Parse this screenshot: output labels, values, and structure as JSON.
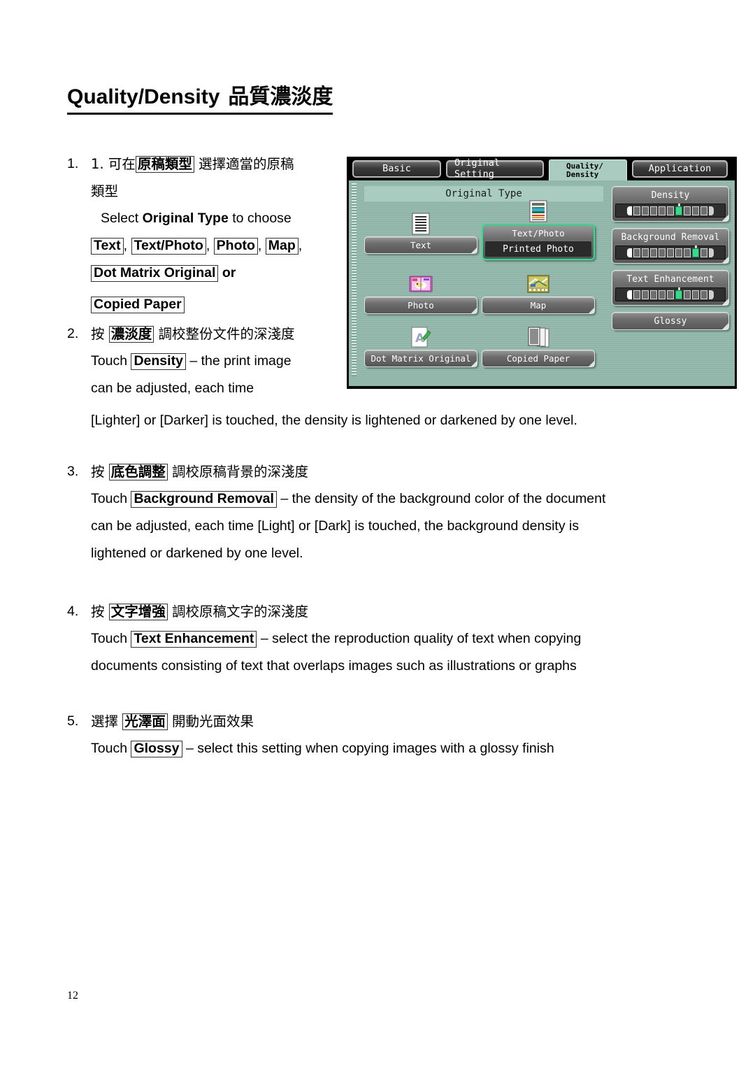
{
  "document": {
    "title_en": "Quality/Density",
    "title_cjk": "品質濃淡度",
    "page_number": "12"
  },
  "steps": [
    {
      "num": "1.",
      "cjk_num": "1.",
      "cjk_lead": "可在",
      "cjk_boxed": "原稿類型",
      "cjk_tail": "選擇適當的原稿",
      "cjk_line2": "類型",
      "en_lead": "Select",
      "en_bold": "Original Type",
      "en_tail": "to choose",
      "options": [
        "Text",
        "Text/Photo",
        "Photo",
        "Map",
        "Dot Matrix Original",
        "Copied Paper"
      ],
      "en_or": "or"
    },
    {
      "num": "2.",
      "cjk_lead": "按",
      "cjk_boxed": "濃淡度",
      "cjk_tail": "調校整份文件的深淺度",
      "en_lead": "Touch",
      "en_boxed": "Density",
      "en_line1": "– the print image",
      "en_line2": "can be adjusted, each time",
      "en_line3": "[Lighter] or [Darker] is touched, the density is lightened or darkened by one level."
    },
    {
      "num": "3.",
      "cjk_lead": "按",
      "cjk_boxed": "底色調整",
      "cjk_tail": "調校原稿背景的深淺度",
      "en_lead": "Touch",
      "en_boxed": "Background Removal",
      "en_line1": "– the density of the background color of the document",
      "en_line2": "can be adjusted, each time [Light] or [Dark] is touched, the background density is",
      "en_line3": "lightened or darkened by one level."
    },
    {
      "num": "4.",
      "cjk_lead": "按",
      "cjk_boxed": "文字增強",
      "cjk_tail": "調校原稿文字的深淺度",
      "en_lead": "Touch",
      "en_boxed": "Text Enhancement",
      "en_line1": "– select the reproduction quality of text when copying",
      "en_line2": "documents consisting of text that overlaps images such as illustrations or graphs"
    },
    {
      "num": "5.",
      "cjk_lead": "選擇",
      "cjk_boxed": "光澤面",
      "cjk_tail": "開動光面效果",
      "en_lead": "Touch",
      "en_boxed": "Glossy",
      "en_line1": "– select this setting when copying images with a glossy finish"
    }
  ],
  "copier_ui": {
    "tabs": [
      {
        "label": "Basic",
        "active": false
      },
      {
        "label": "Original Setting",
        "active": false
      },
      {
        "label_line1": "Quality/",
        "label_line2": "Density",
        "active": true
      },
      {
        "label": "Application",
        "active": false
      }
    ],
    "section_header": "Original Type",
    "original_types": [
      {
        "label": "Text",
        "icon": "document-lines-icon",
        "selected": false
      },
      {
        "label": "Text/Photo",
        "sub_label": "Printed Photo",
        "icon": "text-photo-icon",
        "selected": true
      },
      {
        "label": "Photo",
        "icon": "photo-album-icon",
        "selected": false
      },
      {
        "label": "Map",
        "icon": "map-icon",
        "selected": false
      },
      {
        "label": "Dot Matrix Original",
        "icon": "dot-matrix-icon",
        "selected": false
      },
      {
        "label": "Copied Paper",
        "icon": "copied-paper-icon",
        "selected": false
      }
    ],
    "adjusters": [
      {
        "label": "Density",
        "segments": 9,
        "active_index": 5
      },
      {
        "label": "Background Removal",
        "segments": 9,
        "active_index": 7
      },
      {
        "label": "Text Enhancement",
        "segments": 9,
        "active_index": 5
      }
    ],
    "glossy_button": "Glossy",
    "colors": {
      "screen_background": "#8fb4a8",
      "header_background": "#a9cbc0",
      "selection_highlight": "#2bdf8e",
      "button_face": "#6d6d6d",
      "bezel": "#000000"
    }
  }
}
